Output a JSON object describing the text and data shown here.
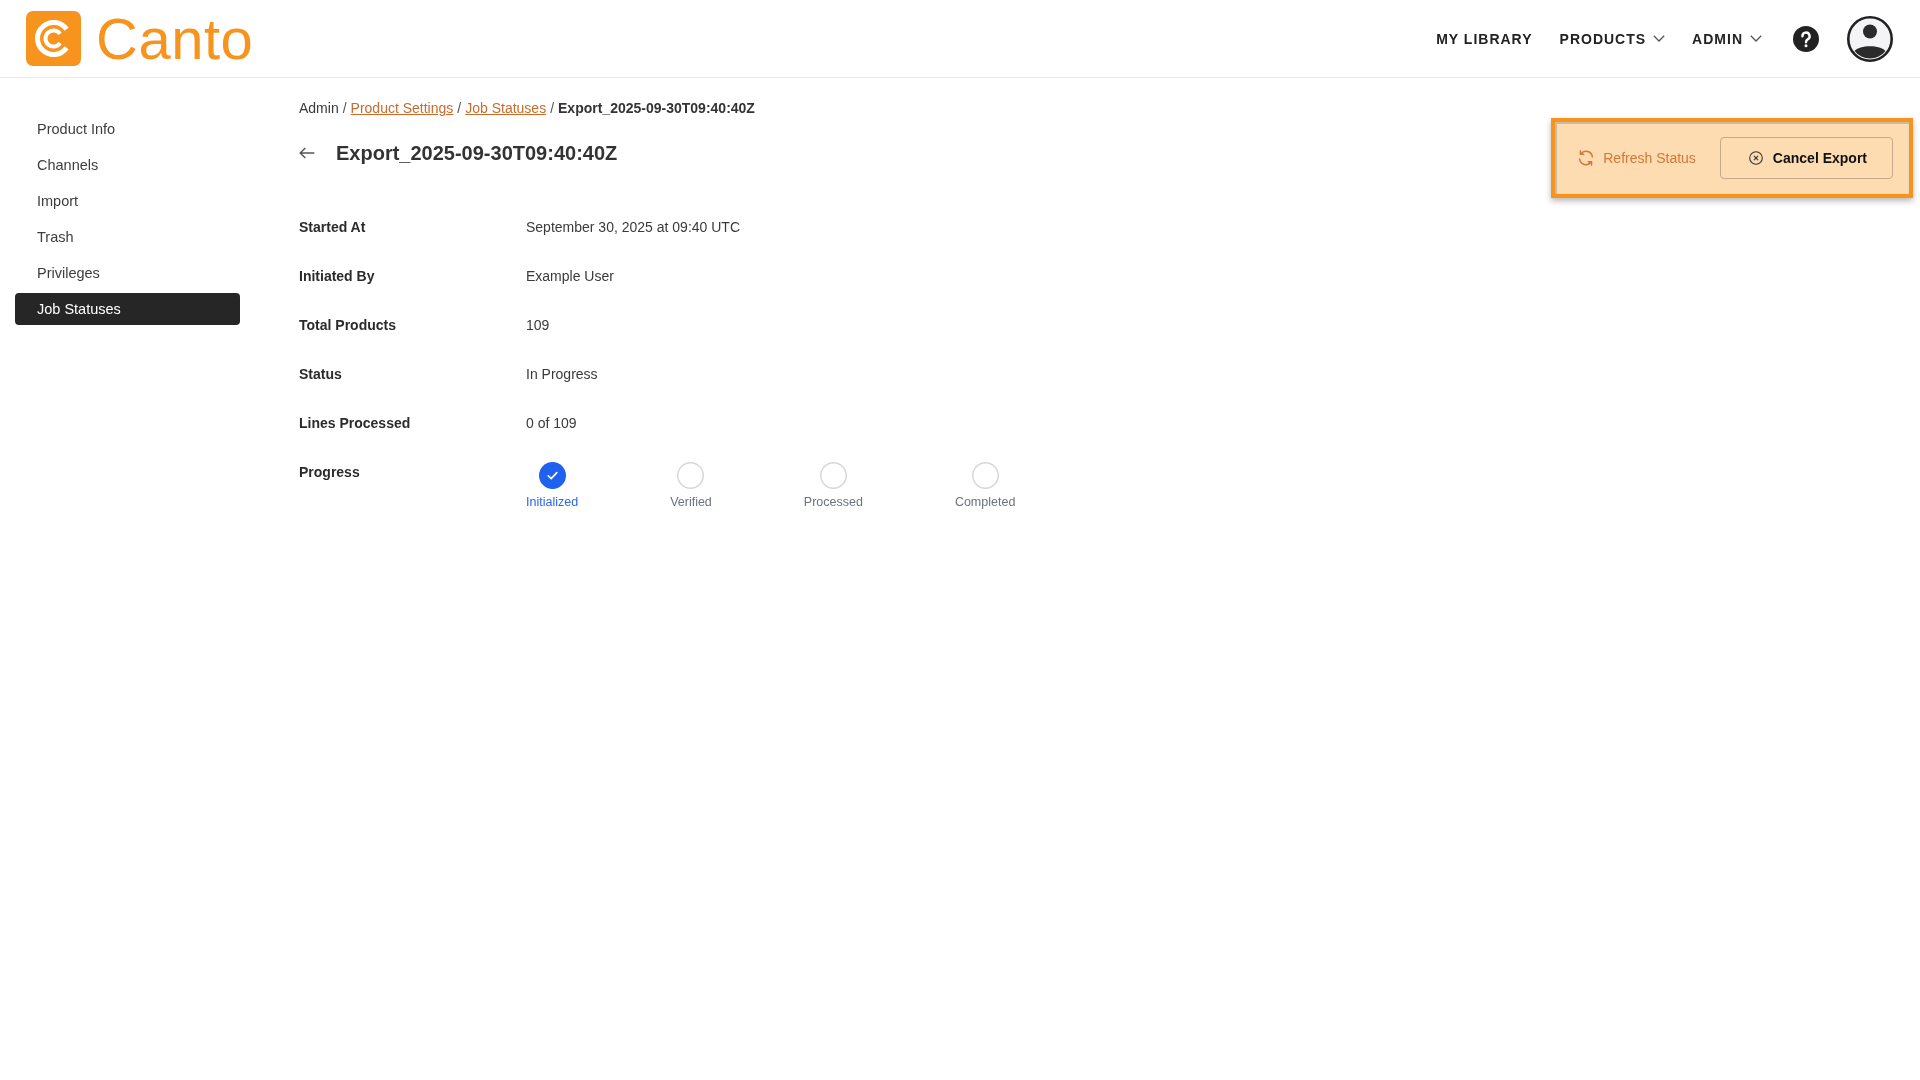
{
  "header": {
    "logo": {
      "text": "Canto"
    },
    "nav": [
      {
        "label": "MY LIBRARY",
        "dropdown": false
      },
      {
        "label": "PRODUCTS",
        "dropdown": true
      },
      {
        "label": "ADMIN",
        "dropdown": true
      }
    ]
  },
  "sidebar": {
    "items": [
      {
        "label": "Product Info",
        "selected": false
      },
      {
        "label": "Channels",
        "selected": false
      },
      {
        "label": "Import",
        "selected": false
      },
      {
        "label": "Trash",
        "selected": false
      },
      {
        "label": "Privileges",
        "selected": false
      },
      {
        "label": "Job Statuses",
        "selected": true
      }
    ]
  },
  "breadcrumb": [
    {
      "label": "Admin",
      "kind": "text"
    },
    {
      "label": "/",
      "kind": "separator"
    },
    {
      "label": "Product Settings",
      "kind": "link"
    },
    {
      "label": "/",
      "kind": "separator"
    },
    {
      "label": "Job Statuses",
      "kind": "link"
    },
    {
      "label": "/",
      "kind": "separator"
    },
    {
      "label": "Export_2025-09-30T09:40:40Z",
      "kind": "current"
    }
  ],
  "page": {
    "title": "Export_2025-09-30T09:40:40Z"
  },
  "details": [
    {
      "label": "Started At",
      "value": "September 30, 2025 at 09:40 UTC"
    },
    {
      "label": "Initiated By",
      "value": "Example User"
    },
    {
      "label": "Total Products",
      "value": "109"
    },
    {
      "label": "Status",
      "value": "In Progress"
    },
    {
      "label": "Lines Processed",
      "value": "0 of 109"
    }
  ],
  "progress": {
    "label": "Progress",
    "steps": [
      {
        "label": "Initialized",
        "done": true
      },
      {
        "label": "Verified",
        "done": false
      },
      {
        "label": "Processed",
        "done": false
      },
      {
        "label": "Completed",
        "done": false
      }
    ]
  },
  "actions": {
    "highlighted": true,
    "buttons": [
      {
        "label": "Refresh Status",
        "kind": "refresh"
      },
      {
        "label": "Cancel Export",
        "kind": "cancel"
      }
    ]
  }
}
